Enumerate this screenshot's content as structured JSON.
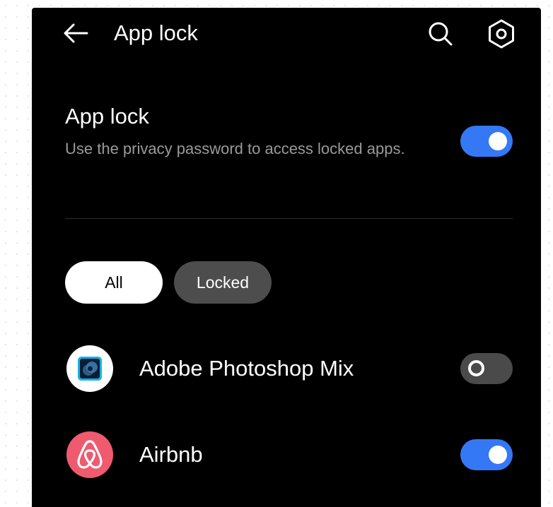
{
  "header": {
    "title": "App lock",
    "back_icon": "arrow-left-icon",
    "search_icon": "search-icon",
    "settings_icon": "hexagon-settings-icon"
  },
  "master_setting": {
    "title": "App lock",
    "description": "Use the privacy password to access locked apps.",
    "enabled": true
  },
  "filters": {
    "all_label": "All",
    "locked_label": "Locked",
    "selected": "All"
  },
  "apps": [
    {
      "name": "Adobe Photoshop Mix",
      "icon": "photoshop-mix-icon",
      "locked": false
    },
    {
      "name": "Airbnb",
      "icon": "airbnb-icon",
      "locked": true
    }
  ],
  "colors": {
    "background": "#000000",
    "accent": "#3478f6",
    "toggle_off": "#4a4a4a",
    "secondary_text": "#9a9a9a",
    "airbnb_brand": "#ef5a6f"
  }
}
